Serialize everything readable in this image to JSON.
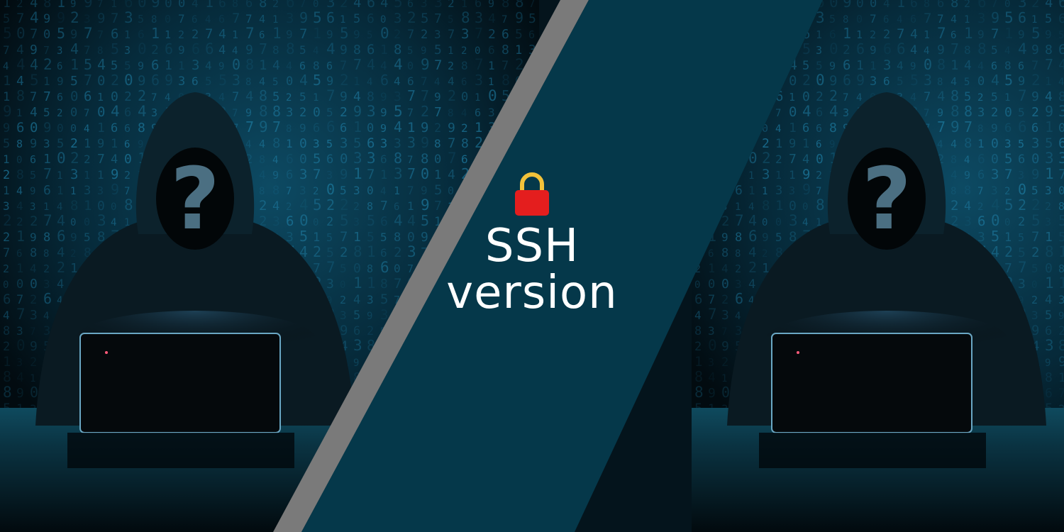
{
  "banner": {
    "title_line1": "SSH",
    "title_line2": "version",
    "face_glyph": "?",
    "lock_icon": "lock-icon"
  },
  "colors": {
    "panel": "#05384a",
    "stripe": "#7a7a7a",
    "lock_body": "#e41e1e",
    "lock_shackle": "#f2c23a",
    "text": "#ffffff",
    "matrix_digits": "#1f7fa6"
  }
}
